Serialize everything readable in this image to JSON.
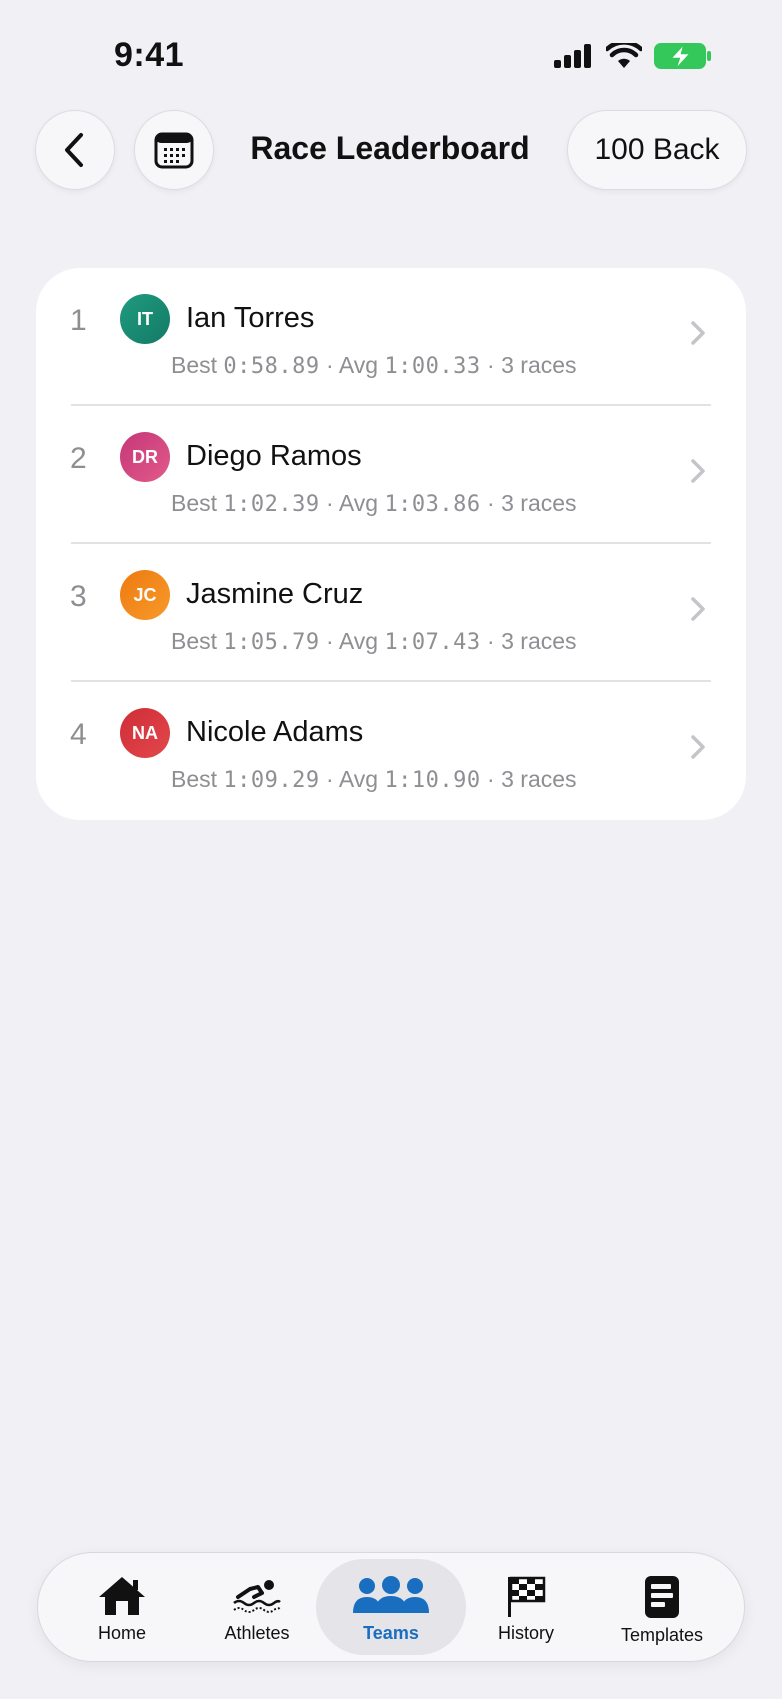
{
  "status": {
    "time": "9:41"
  },
  "header": {
    "title": "Race Leaderboard",
    "event": "100 Back"
  },
  "leaderboard": [
    {
      "rank": "1",
      "initials": "IT",
      "name": "Ian Torres",
      "best": "0:58.89",
      "avg": "1:00.33",
      "races": "3 races",
      "color": "#1a8a72"
    },
    {
      "rank": "2",
      "initials": "DR",
      "name": "Diego Ramos",
      "best": "1:02.39",
      "avg": "1:03.86",
      "races": "3 races",
      "color": "#d6447c"
    },
    {
      "rank": "3",
      "initials": "JC",
      "name": "Jasmine Cruz",
      "best": "1:05.79",
      "avg": "1:07.43",
      "races": "3 races",
      "color": "#f18a18"
    },
    {
      "rank": "4",
      "initials": "NA",
      "name": "Nicole Adams",
      "best": "1:09.29",
      "avg": "1:10.90",
      "races": "3 races",
      "color": "#d8363d"
    }
  ],
  "labels": {
    "best": "Best",
    "avg": "Avg",
    "sep": "·"
  },
  "tabs": [
    {
      "label": "Home",
      "icon": "house-icon"
    },
    {
      "label": "Athletes",
      "icon": "swimmer-icon"
    },
    {
      "label": "Teams",
      "icon": "people-icon",
      "active": true
    },
    {
      "label": "History",
      "icon": "checkered-flag-icon"
    },
    {
      "label": "Templates",
      "icon": "document-icon"
    }
  ],
  "colors": {
    "accent": "#1a6ec0",
    "background": "#f0f0f5"
  }
}
